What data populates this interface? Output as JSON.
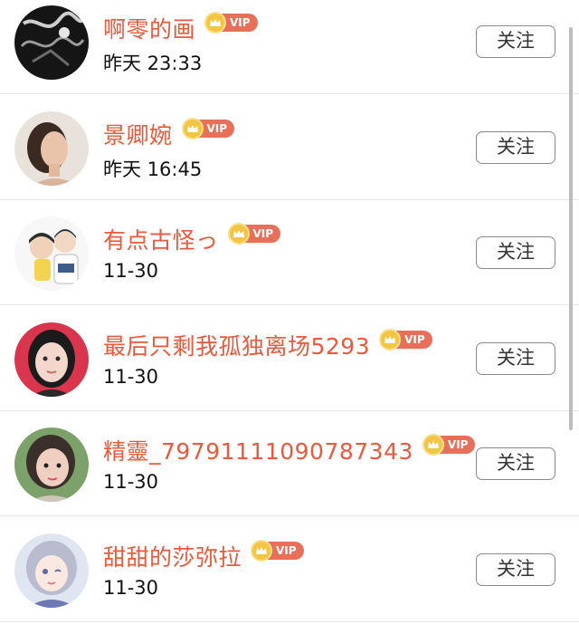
{
  "follow_label": "关注",
  "vip_label": "VIP",
  "colors": {
    "name": "#e9593c",
    "vip_badge": "#e8705a",
    "crown": "#f4c542",
    "divider": "#e6e6e6",
    "button_border": "#8a8a8a"
  },
  "users": [
    {
      "name": "啊零的画",
      "time": "昨天 23:33",
      "avatar": "dark-artwork-avatar",
      "vip": true
    },
    {
      "name": "景卿婉",
      "time": "昨天 16:45",
      "avatar": "portrait-avatar",
      "vip": true
    },
    {
      "name": "有点古怪っ",
      "time": "11-30",
      "avatar": "cartoon-couple-avatar",
      "vip": true
    },
    {
      "name": "最后只剩我孤独离场5293",
      "time": "11-30",
      "avatar": "selfie-girl-avatar",
      "vip": true
    },
    {
      "name": "精靈_79791111090787343",
      "time": "11-30",
      "avatar": "selfie-girl-avatar",
      "vip": true
    },
    {
      "name": "甜甜的莎弥拉",
      "time": "11-30",
      "avatar": "anime-girl-avatar",
      "vip": true
    }
  ]
}
